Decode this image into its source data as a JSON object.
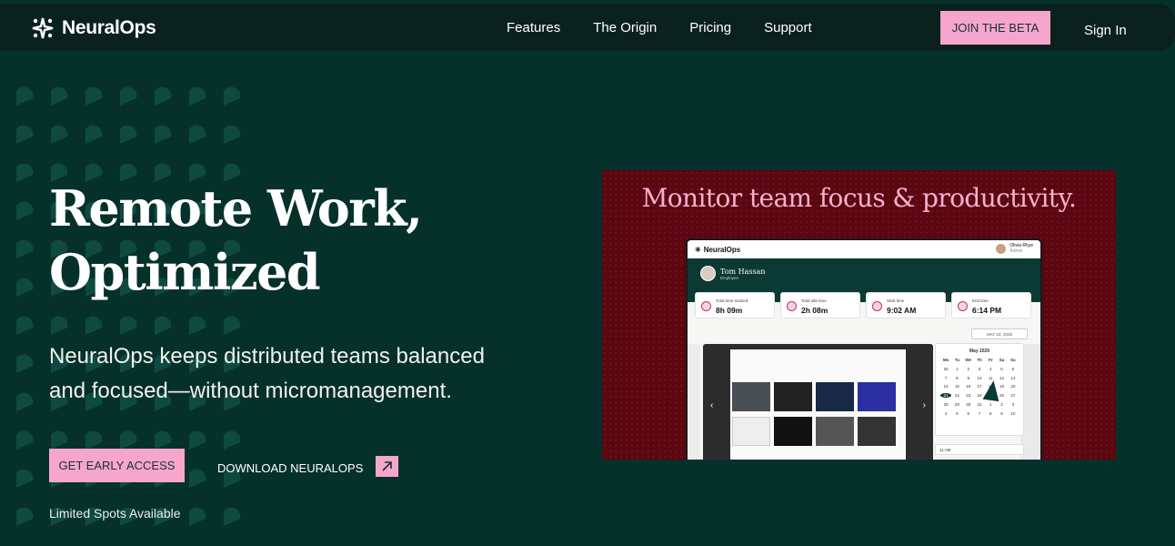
{
  "nav": {
    "brand": "NeuralOps",
    "links": [
      "Features",
      "The Origin",
      "Pricing",
      "Support"
    ],
    "join_label": "JOIN THE BETA",
    "signin_label": "Sign In"
  },
  "hero": {
    "title_line1": "Remote Work,",
    "title_line2": "Optimized",
    "subtitle_line1": "NeuralOps keeps distributed teams balanced",
    "subtitle_line2": "and focused—without micromanagement.",
    "cta_primary": "GET EARLY ACCESS",
    "cta_secondary": "DOWNLOAD NEURALOPS",
    "note": "Limited Spots Available"
  },
  "panel": {
    "title": "Monitor team focus & productivity.",
    "app_brand": "NeuralOps",
    "user_name": "Olivia Rhye",
    "user_role": "Admin",
    "employee_name": "Tom Hassan",
    "employee_role": "Employee",
    "stats": [
      {
        "label": "Total time tracked",
        "value": "8h 09m"
      },
      {
        "label": "Total Idle time",
        "value": "2h 08m"
      },
      {
        "label": "Start time",
        "value": "9:02 AM"
      },
      {
        "label": "End time",
        "value": "6:14 PM"
      }
    ],
    "date": "MAY 22, 2026",
    "calendar_month": "May 2026",
    "calendar_days": [
      "Mo",
      "Tu",
      "We",
      "Th",
      "Fr",
      "Sa",
      "Su"
    ],
    "calendar_dates": [
      "30",
      "1",
      "2",
      "3",
      "4",
      "5",
      "6",
      "7",
      "8",
      "9",
      "10",
      "11",
      "12",
      "13",
      "14",
      "15",
      "16",
      "17",
      "18",
      "19",
      "20",
      "21",
      "22",
      "23",
      "24",
      "25",
      "26",
      "27",
      "28",
      "29",
      "30",
      "31",
      "1",
      "2",
      "3",
      "4",
      "5",
      "6",
      "7",
      "8",
      "9",
      "10"
    ],
    "selected_date": "20",
    "time_slot": "11 AM"
  },
  "colors": {
    "background": "#06312b",
    "nav": "#0b211d",
    "accent_pink": "#f6a6cd",
    "panel": "#5b0610"
  }
}
